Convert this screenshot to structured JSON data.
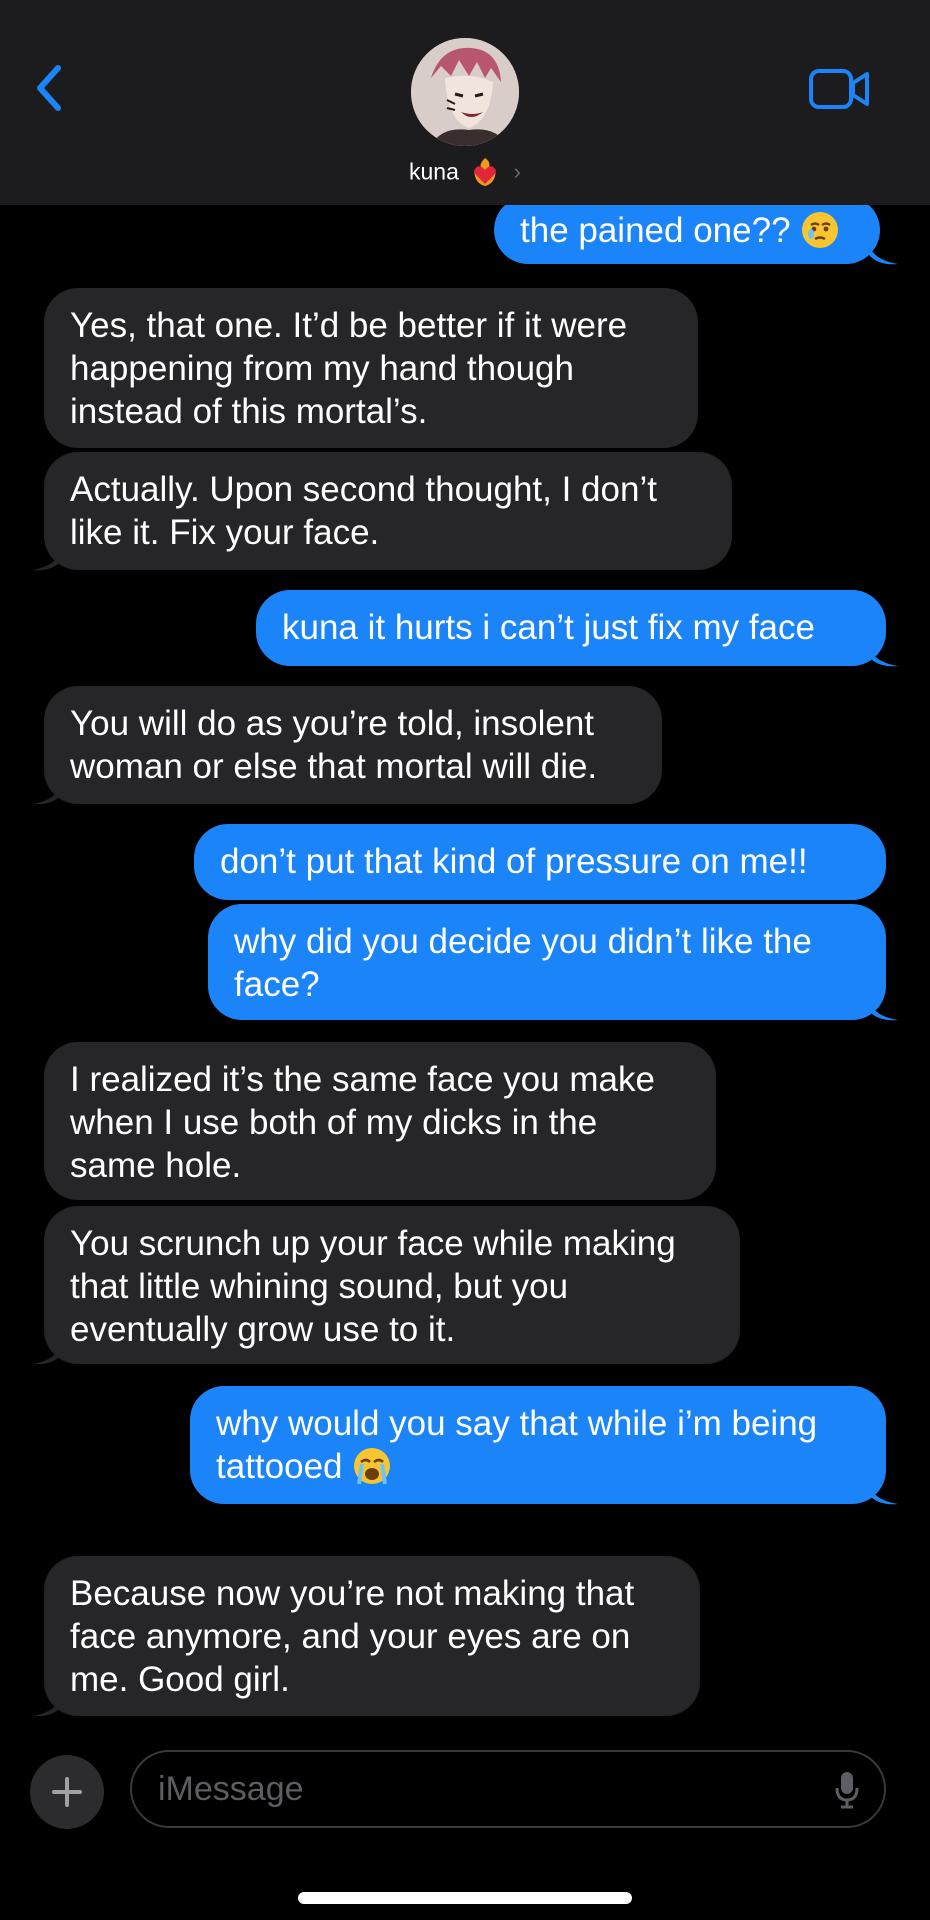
{
  "header": {
    "contact_name": "kuna",
    "back_icon": "chevron-left-icon",
    "video_icon": "video-camera-icon",
    "name_emoji": "heart-on-fire-emoji",
    "accent": "#1a84f8"
  },
  "messages": [
    {
      "from": "me",
      "text": "the pained one??",
      "emoji": "face-holding-back-tears"
    },
    {
      "from": "them",
      "text": "Yes, that one. It’d be better if it were happening from my hand though instead of this mortal’s."
    },
    {
      "from": "them",
      "text": "Actually. Upon second thought, I don’t like it. Fix your face."
    },
    {
      "from": "me",
      "text": "kuna it hurts i can’t just fix my face"
    },
    {
      "from": "them",
      "text": "You will do as you’re told, insolent woman or else that mortal will die."
    },
    {
      "from": "me",
      "text": "don’t put that kind of pressure on me!!"
    },
    {
      "from": "me",
      "text": "why did you decide you didn’t like the face?"
    },
    {
      "from": "them",
      "text": "I realized it’s the same face you make when I use both of my dicks in the same hole."
    },
    {
      "from": "them",
      "text": "You scrunch up your face while making that little whining sound, but you eventually grow use to it."
    },
    {
      "from": "me",
      "text": "why would you say that while i’m being tattooed",
      "emoji": "loudly-crying-face"
    },
    {
      "from": "them",
      "text": "Because now you’re not making that face anymore, and your eyes are on me. Good girl."
    }
  ],
  "composer": {
    "placeholder": "iMessage",
    "plus_icon": "plus-icon",
    "mic_icon": "microphone-icon"
  },
  "colors": {
    "incoming_bubble": "#262628",
    "outgoing_bubble": "#1a84f8",
    "header_bg": "#1c1c1e"
  }
}
